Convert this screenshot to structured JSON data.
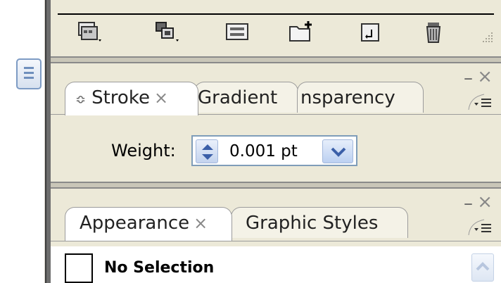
{
  "toolbar": {
    "icons": [
      "swatch-libraries-icon",
      "symbol-icon",
      "options-icon",
      "new-layer-icon",
      "new-sublayer-icon",
      "delete-icon"
    ]
  },
  "stroke_panel": {
    "tabs": [
      {
        "label": "Stroke",
        "close": "×"
      },
      {
        "label": "Gradient"
      },
      {
        "label": "nsparency"
      }
    ],
    "minimize": "–",
    "close": "×",
    "weight_label": "Weight:",
    "weight_value": "0.001 pt"
  },
  "appearance_panel": {
    "tabs": [
      {
        "label": "Appearance",
        "close": "×"
      },
      {
        "label": "Graphic Styles"
      }
    ],
    "minimize": "–",
    "close": "×",
    "selection_text": "No Selection"
  }
}
